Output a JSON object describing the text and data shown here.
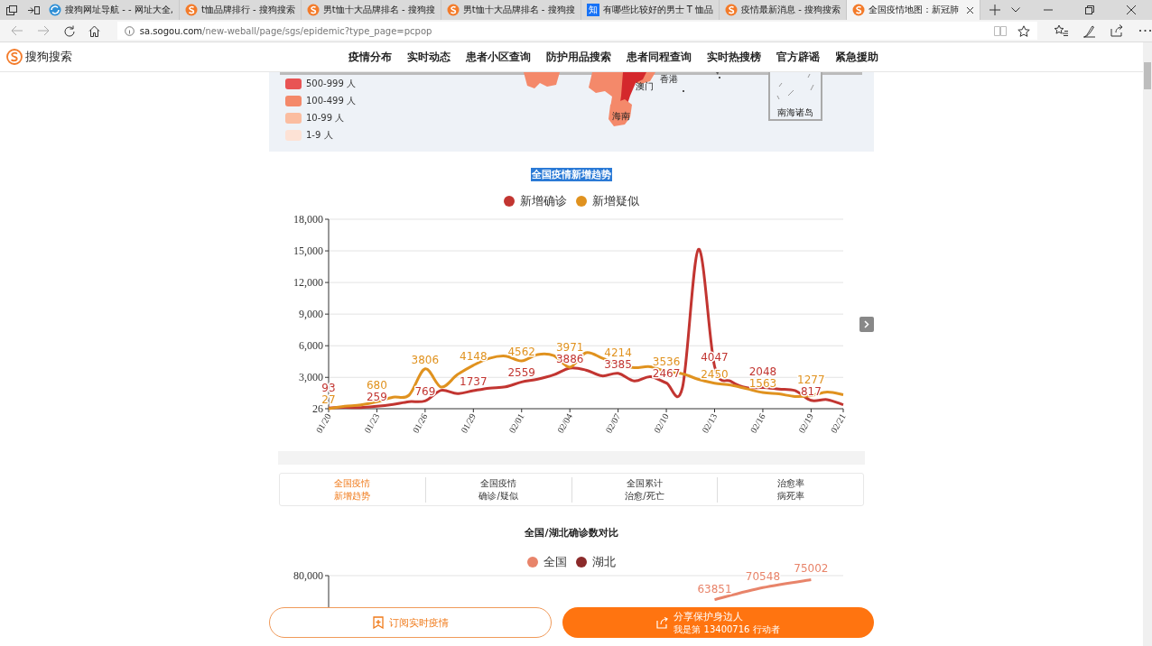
{
  "browser": {
    "tabs": [
      {
        "title": "搜狗网址导航 - - 网址大全,",
        "kind": "globe",
        "selected": false
      },
      {
        "title": "t恤品牌排行 - 搜狗搜索",
        "kind": "sogou",
        "selected": false
      },
      {
        "title": "男t恤十大品牌排名 - 搜狗搜",
        "kind": "sogou",
        "selected": false
      },
      {
        "title": "男t恤十大品牌排名 - 搜狗搜",
        "kind": "sogou",
        "selected": false
      },
      {
        "title": "有哪些比较好的男士 T 恤品",
        "kind": "zhihu",
        "badge": "知",
        "selected": false
      },
      {
        "title": "疫情最新消息 - 搜狗搜索",
        "kind": "sogou",
        "selected": false
      },
      {
        "title": "全国疫情地图：新冠肺",
        "kind": "sogou",
        "selected": true
      }
    ],
    "address": {
      "domain": "sa.sogou.com",
      "path": "/new-weball/page/sgs/epidemic?type_page=pcpop"
    }
  },
  "header": {
    "logo": "搜狗搜索",
    "nav": [
      "疫情分布",
      "实时动态",
      "患者小区查询",
      "防护用品搜索",
      "患者同程查询",
      "实时热搜榜",
      "官方辟谣",
      "紧急援助"
    ]
  },
  "map": {
    "legend": [
      {
        "label": "500-999 人",
        "color": "#e85454"
      },
      {
        "label": "100-499 人",
        "color": "#f4896a"
      },
      {
        "label": "10-99 人",
        "color": "#fbbda0"
      },
      {
        "label": "1-9 人",
        "color": "#fde2d5"
      }
    ],
    "places": [
      "香港",
      "澳门",
      "海南",
      "南海诸岛"
    ]
  },
  "trend": {
    "title": "全国疫情新增趋势",
    "chart_data": {
      "type": "line",
      "grid": true,
      "categories": [
        "01/20",
        null,
        null,
        "01/23",
        null,
        null,
        "01/26",
        null,
        null,
        "01/29",
        null,
        null,
        "02/01",
        null,
        null,
        "02/04",
        null,
        null,
        "02/07",
        null,
        null,
        "02/10",
        null,
        null,
        "02/13",
        null,
        null,
        "02/16",
        null,
        null,
        "02/19",
        null,
        "02/21"
      ],
      "ylim": [
        26,
        18000
      ],
      "yticks": [
        26,
        {
          "value": 3000,
          "label": "3,000"
        },
        {
          "value": 6000,
          "label": "6,000"
        },
        {
          "value": 9000,
          "label": "9,000"
        },
        {
          "value": 12000,
          "label": "12,000"
        },
        {
          "value": 15000,
          "label": "15,000"
        },
        {
          "value": 18000,
          "label": "18,000"
        }
      ],
      "series": [
        {
          "name": "新增确诊",
          "color": "#c23531",
          "values": [
            93,
            150,
            130,
            259,
            440,
            690,
            769,
            1770,
            1460,
            1737,
            1980,
            2100,
            2559,
            2830,
            3240,
            3886,
            3690,
            3140,
            3385,
            2650,
            3060,
            2467,
            2020,
            15150,
            4047,
            2640,
            2010,
            2048,
            1890,
            1750,
            817,
            890,
            400
          ]
        },
        {
          "name": "新增疑似",
          "color": "#e0921f",
          "values": [
            27,
            260,
            390,
            680,
            1120,
            1310,
            3806,
            2080,
            3250,
            4148,
            4810,
            5020,
            4562,
            5170,
            5070,
            3971,
            5330,
            4830,
            4214,
            3920,
            4010,
            3536,
            3340,
            2810,
            2450,
            2280,
            1920,
            1563,
            1430,
            1190,
            1277,
            1610,
            1360
          ]
        }
      ],
      "annotations": [
        {
          "x": "01/20",
          "y": 93,
          "text": "93"
        },
        {
          "x": "01/23",
          "y": 259,
          "text": "259"
        },
        {
          "x": "01/26",
          "y": 769,
          "text": "769"
        },
        {
          "x": "01/29",
          "y": 1737,
          "text": "1737"
        },
        {
          "x": "02/01",
          "y": 2559,
          "text": "2559"
        },
        {
          "x": "02/04",
          "y": 3886,
          "text": "3886"
        },
        {
          "x": "02/07",
          "y": 3385,
          "text": "3385"
        },
        {
          "x": "02/10",
          "y": 2467,
          "text": "2467"
        },
        {
          "x": "02/13",
          "y": 4047,
          "text": "4047"
        },
        {
          "x": "02/16",
          "y": 2048,
          "text": "2048"
        },
        {
          "x": "02/19",
          "y": 817,
          "text": "817"
        },
        {
          "x": "01/20",
          "y": 27,
          "text": "27"
        },
        {
          "x": "01/23",
          "y": 680,
          "text": "680"
        },
        {
          "x": "01/26",
          "y": 3806,
          "text": "3806"
        },
        {
          "x": "01/29",
          "y": 4148,
          "text": "4148"
        },
        {
          "x": "02/01",
          "y": 4562,
          "text": "4562"
        },
        {
          "x": "02/04",
          "y": 3971,
          "text": "3971"
        },
        {
          "x": "02/07",
          "y": 4214,
          "text": "4214"
        },
        {
          "x": "02/10",
          "y": 3536,
          "text": "3536"
        },
        {
          "x": "02/13",
          "y": 2450,
          "text": "2450"
        },
        {
          "x": "02/16",
          "y": 1563,
          "text": "1563"
        },
        {
          "x": "02/19",
          "y": 1277,
          "text": "1277"
        }
      ]
    }
  },
  "switcher": [
    {
      "lines": [
        "全国疫情",
        "新增趋势"
      ],
      "selected": true
    },
    {
      "lines": [
        "全国疫情",
        "确诊/疑似"
      ],
      "selected": false
    },
    {
      "lines": [
        "全国累计",
        "治愈/死亡"
      ],
      "selected": false
    },
    {
      "lines": [
        "治愈率",
        "病死率"
      ],
      "selected": false
    }
  ],
  "compare": {
    "title": "全国/湖北确诊数对比",
    "chart_data": {
      "type": "line",
      "series": [
        {
          "name": "全国",
          "color": "#e8846a",
          "values": [
            null,
            null,
            null,
            null,
            null,
            null,
            null,
            null,
            null,
            null,
            null,
            null,
            null,
            null,
            null,
            null,
            null,
            null,
            null,
            null,
            null,
            null,
            null,
            null,
            63851,
            null,
            null,
            70548,
            null,
            null,
            75002,
            null,
            null
          ]
        },
        {
          "name": "湖北",
          "color": "#8b2a2a"
        }
      ],
      "data_labels": true,
      "annotations": [
        "80,000"
      ]
    }
  },
  "actions": {
    "subscribe": "订阅实时疫情",
    "share": "分享保护身边人",
    "share_note": "我是第 13400716 行动者"
  }
}
